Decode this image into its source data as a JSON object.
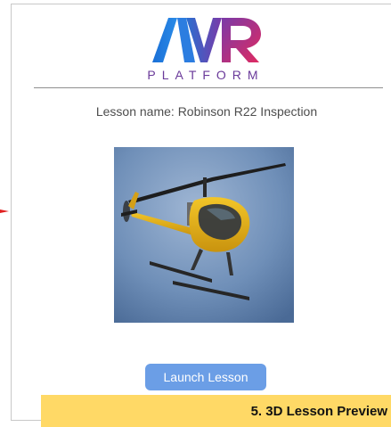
{
  "logo": {
    "letters": "AVR",
    "subtitle": "PLATFORM",
    "colors": {
      "blue": "#1a6fd6",
      "purple": "#6a3a9a",
      "pink": "#d72a6a"
    }
  },
  "lesson": {
    "name_label": "Lesson name: Robinson R22 Inspection",
    "image": "helicopter-image"
  },
  "actions": {
    "launch_label": "Launch Lesson"
  },
  "caption": {
    "text": "5. 3D Lesson Preview"
  },
  "colors": {
    "button": "#6b9ee6",
    "caption_bg": "#ffd966",
    "annotation_arrow": "#e02020"
  }
}
